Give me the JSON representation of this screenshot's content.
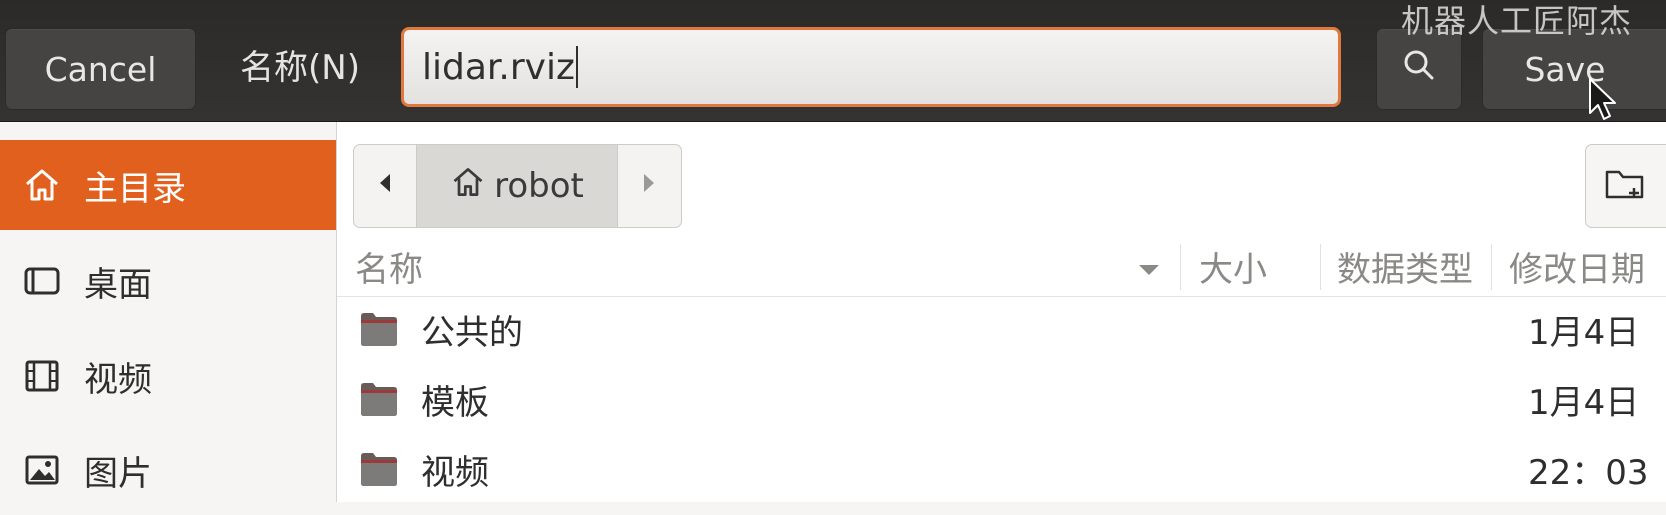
{
  "header": {
    "cancel_label": "Cancel",
    "name_label": "名称(N)",
    "filename_value": "lidar.rviz",
    "search_icon": "search-icon",
    "save_label": "Save",
    "watermark": "机器人工匠阿杰"
  },
  "sidebar": {
    "items": [
      {
        "label": "主目录",
        "icon": "home-icon",
        "active": true
      },
      {
        "label": "桌面",
        "icon": "desktop-icon",
        "active": false
      },
      {
        "label": "视频",
        "icon": "video-icon",
        "active": false
      },
      {
        "label": "图片",
        "icon": "picture-icon",
        "active": false
      }
    ]
  },
  "pathbar": {
    "crumb": "robot",
    "crumb_icon": "home-icon"
  },
  "columns": {
    "name": "名称",
    "size": "大小",
    "type": "数据类型",
    "modified": "修改日期"
  },
  "files": [
    {
      "name": "公共的",
      "modified": "1月4日",
      "icon": "folder-icon"
    },
    {
      "name": "模板",
      "modified": "1月4日",
      "icon": "folder-icon"
    },
    {
      "name": "视频",
      "modified": "22：03",
      "icon": "folder-icon"
    }
  ],
  "colors": {
    "accent": "#e2601d",
    "header_bg": "#2b2a29",
    "input_border": "#e0793d"
  }
}
